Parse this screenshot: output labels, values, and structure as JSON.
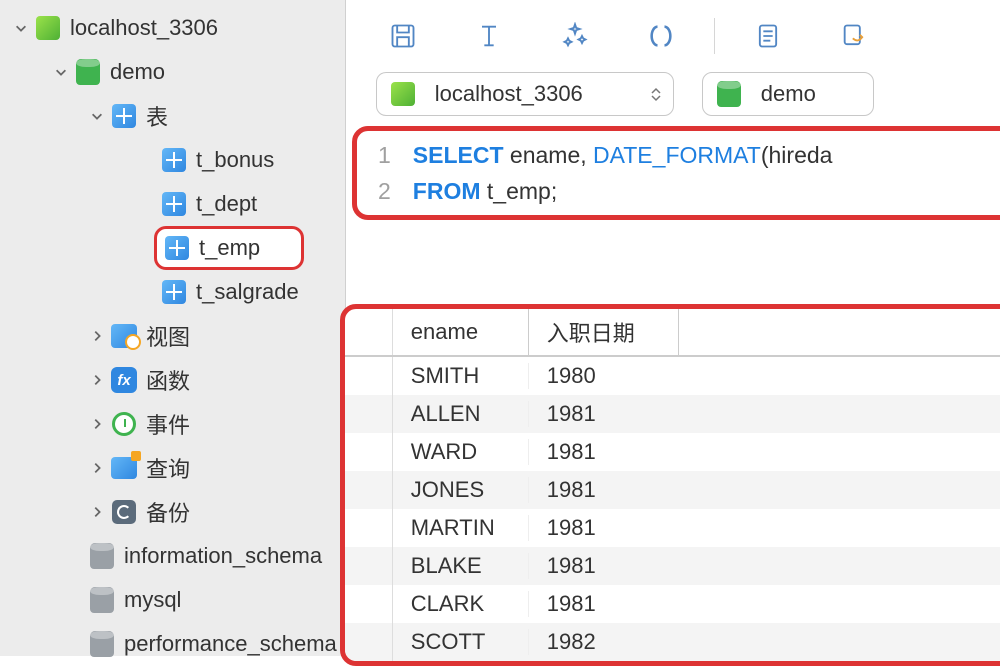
{
  "sidebar": {
    "connection": "localhost_3306",
    "database": "demo",
    "tables_label": "表",
    "tables": [
      "t_bonus",
      "t_dept",
      "t_emp",
      "t_salgrade"
    ],
    "selected_table": "t_emp",
    "sections": {
      "views": "视图",
      "functions": "函数",
      "events": "事件",
      "queries": "查询",
      "backup": "备份"
    },
    "system_dbs": [
      "information_schema",
      "mysql",
      "performance_schema"
    ]
  },
  "toolbar": {
    "connection_selector": "localhost_3306",
    "db_selector": "demo"
  },
  "sql": {
    "lines": [
      {
        "n": "1",
        "tokens": [
          {
            "t": "SELECT",
            "c": "kw"
          },
          {
            "t": " ename, ",
            "c": "txt"
          },
          {
            "t": "DATE_FORMAT",
            "c": "fn"
          },
          {
            "t": "(hireda",
            "c": "txt"
          }
        ]
      },
      {
        "n": "2",
        "tokens": [
          {
            "t": "FROM",
            "c": "kw"
          },
          {
            "t": " t_emp;",
            "c": "txt"
          }
        ]
      }
    ]
  },
  "results": {
    "columns": [
      "ename",
      "入职日期"
    ],
    "rows": [
      [
        "SMITH",
        "1980"
      ],
      [
        "ALLEN",
        "1981"
      ],
      [
        "WARD",
        "1981"
      ],
      [
        "JONES",
        "1981"
      ],
      [
        "MARTIN",
        "1981"
      ],
      [
        "BLAKE",
        "1981"
      ],
      [
        "CLARK",
        "1981"
      ],
      [
        "SCOTT",
        "1982"
      ]
    ]
  }
}
